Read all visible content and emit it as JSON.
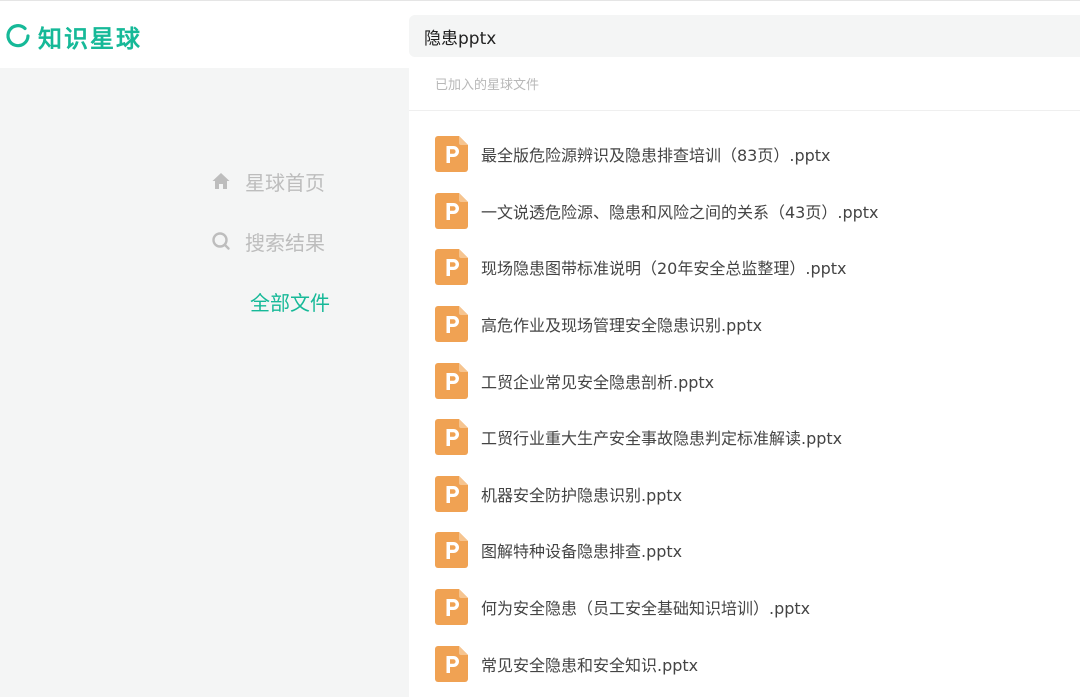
{
  "app": {
    "logo_text": "知识星球",
    "brand_color": "#16b998",
    "logo_icon": "planet-ring-icon"
  },
  "search": {
    "value": "隐患pptx",
    "icon": "search-icon"
  },
  "sidebar": {
    "items": [
      {
        "label": "星球首页",
        "icon": "home-icon",
        "active": false
      },
      {
        "label": "搜索结果",
        "icon": "search-icon",
        "active": false
      },
      {
        "label": "全部文件",
        "icon": "",
        "active": true
      }
    ]
  },
  "main": {
    "section_label": "已加入的星球文件",
    "file_icon": "pptx-file-icon",
    "file_icon_color": "#f0a253",
    "files": [
      {
        "name": "最全版危险源辨识及隐患排查培训（83页）.pptx"
      },
      {
        "name": "一文说透危险源、隐患和风险之间的关系（43页）.pptx"
      },
      {
        "name": "现场隐患图带标准说明（20年安全总监整理）.pptx"
      },
      {
        "name": "高危作业及现场管理安全隐患识别.pptx"
      },
      {
        "name": "工贸企业常见安全隐患剖析.pptx"
      },
      {
        "name": "工贸行业重大生产安全事故隐患判定标准解读.pptx"
      },
      {
        "name": "机器安全防护隐患识别.pptx"
      },
      {
        "name": "图解特种设备隐患排查.pptx"
      },
      {
        "name": "何为安全隐患（员工安全基础知识培训）.pptx"
      },
      {
        "name": "常见安全隐患和安全知识.pptx"
      }
    ]
  }
}
